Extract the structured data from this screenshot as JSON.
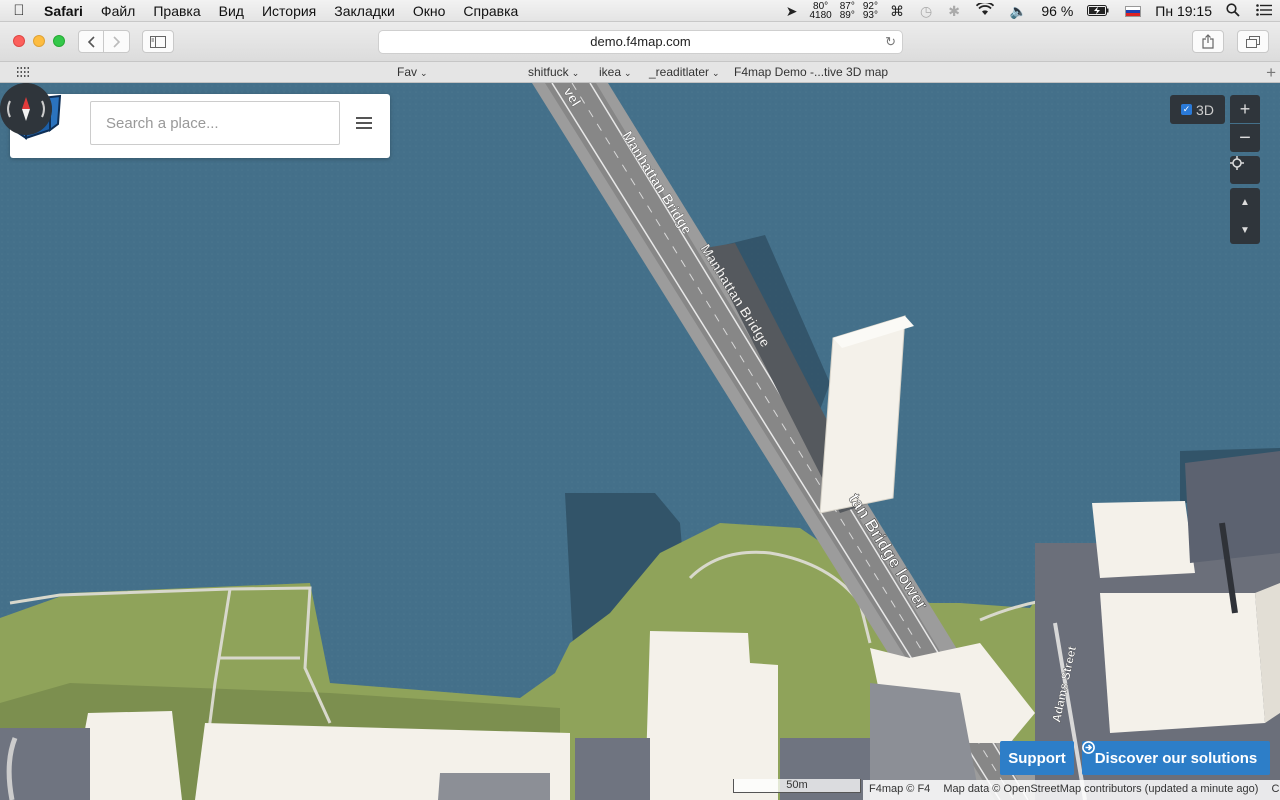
{
  "menubar": {
    "app_name": "Safari",
    "items": [
      "Файл",
      "Правка",
      "Вид",
      "История",
      "Закладки",
      "Окно",
      "Справка"
    ],
    "stats": [
      {
        "top": "80°",
        "bottom": "4180"
      },
      {
        "top": "87°",
        "bottom": "89°"
      },
      {
        "top": "92°",
        "bottom": "93°"
      }
    ],
    "battery": "96 %",
    "clock": "Пн 19:15"
  },
  "toolbar": {
    "url": "demo.f4map.com"
  },
  "bookmarks": {
    "items": [
      "Fav",
      "shitfuck",
      "ikea",
      "_readitlater",
      "F4map Demo -...tive 3D map"
    ]
  },
  "map": {
    "search_placeholder": "Search a place...",
    "toggle_3d_label": "3D",
    "labels": {
      "bridge_top": "vel",
      "bridge_1": "Manhattan Bridge",
      "bridge_2": "Manhattan Bridge",
      "bridge_lower": "tan Bridge lower",
      "street": "Adams Street"
    },
    "scale_label": "50m",
    "attribution": {
      "f4": "F4map © F4",
      "osm": "Map data © OpenStreetMap contributors (updated a minute ago)",
      "credits": "Credits"
    },
    "support_label": "Support",
    "discover_label": "Discover our solutions",
    "colors": {
      "water": "#44708a",
      "park": "#8fa35a",
      "building": "#f4f1ea",
      "road": "#9c9c9c",
      "accent": "#2d7ec8"
    }
  }
}
